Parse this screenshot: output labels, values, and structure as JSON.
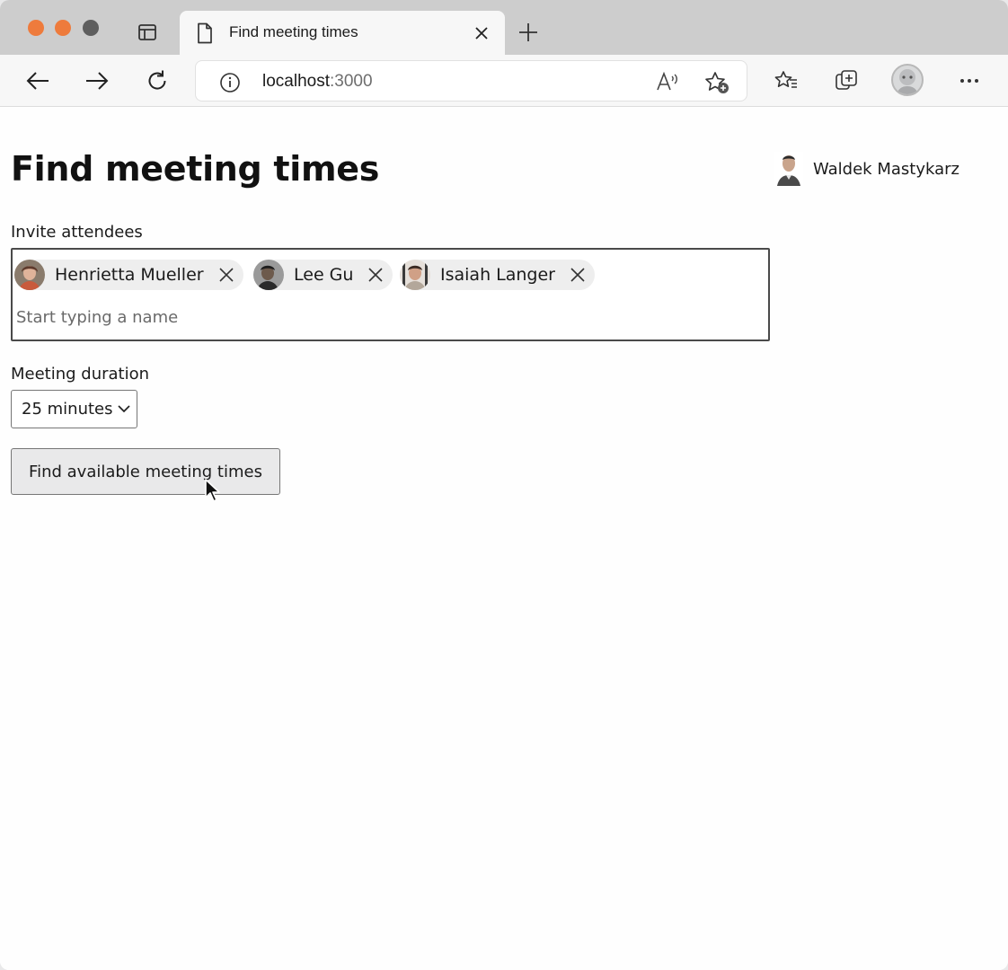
{
  "browser": {
    "tab": {
      "title": "Find meeting times"
    },
    "address": {
      "host": "localhost",
      "port": ":3000"
    }
  },
  "page": {
    "title": "Find meeting times",
    "user": {
      "name": "Waldek Mastykarz"
    },
    "invite": {
      "label": "Invite attendees",
      "attendees": [
        {
          "name": "Henrietta Mueller"
        },
        {
          "name": "Lee Gu"
        },
        {
          "name": "Isaiah Langer"
        }
      ],
      "placeholder": "Start typing a name"
    },
    "duration": {
      "label": "Meeting duration",
      "selected": "25 minutes"
    },
    "find_button": "Find available meeting times"
  },
  "colors": {
    "traffic_light": "#ee7b3c",
    "tab_strip": "#cdcdcd",
    "input_border": "#4a4a4a"
  }
}
